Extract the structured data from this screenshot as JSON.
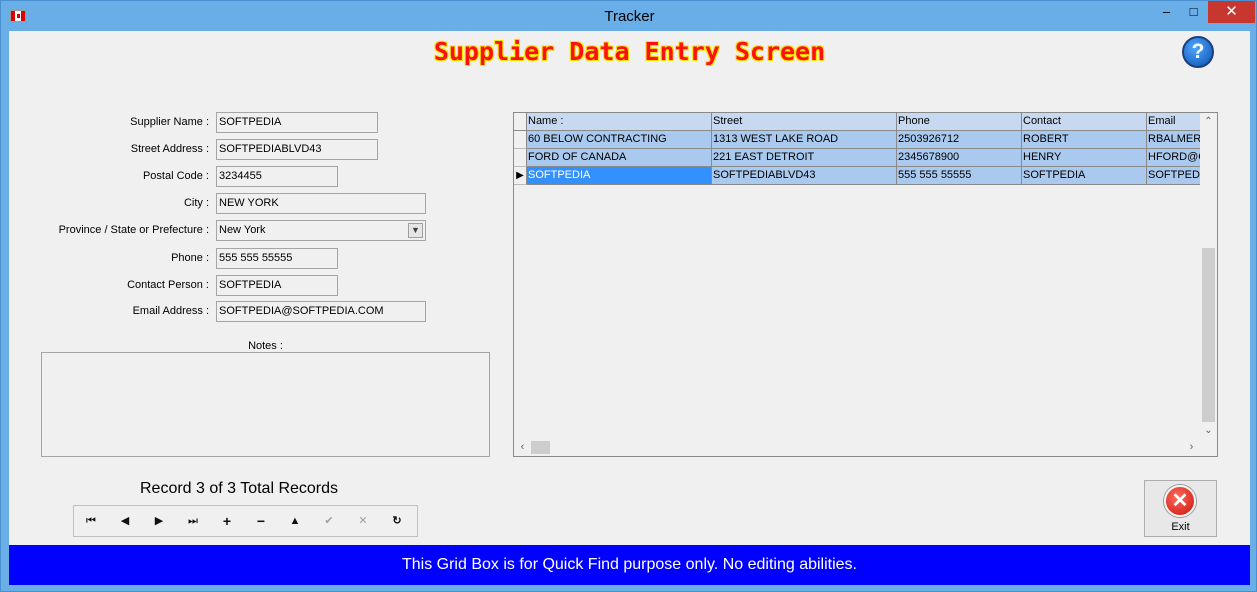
{
  "window": {
    "title": "Tracker",
    "minimize_glyph": "–",
    "maximize_glyph": "□",
    "close_glyph": "✕"
  },
  "screen_title": "Supplier Data Entry Screen",
  "help_glyph": "?",
  "form": {
    "supplier_name": {
      "label": "Supplier Name :",
      "value": "SOFTPEDIA"
    },
    "street_address": {
      "label": "Street Address :",
      "value": "SOFTPEDIABLVD43"
    },
    "postal_code": {
      "label": "Postal Code :",
      "value": "3234455"
    },
    "city": {
      "label": "City :",
      "value": "NEW YORK"
    },
    "province": {
      "label": "Province / State or Prefecture :",
      "value": "New York"
    },
    "phone": {
      "label": "Phone :",
      "value": "555 555 55555"
    },
    "contact_person": {
      "label": "Contact Person :",
      "value": "SOFTPEDIA"
    },
    "email_address": {
      "label": "Email Address :",
      "value": "SOFTPEDIA@SOFTPEDIA.COM"
    },
    "notes": {
      "label": "Notes :",
      "value": ""
    }
  },
  "record_status": "Record 3 of 3 Total Records",
  "navigator": {
    "first": "⏮",
    "prev": "◀",
    "next": "▶",
    "last": "⏭",
    "add": "+",
    "delete": "−",
    "edit": "▲",
    "post": "✔",
    "cancel": "✕",
    "refresh": "↻"
  },
  "grid": {
    "columns": [
      "Name :",
      "Street",
      "Phone",
      "Contact",
      "Email"
    ],
    "rows": [
      [
        "60 BELOW CONTRACTING",
        "1313 WEST LAKE ROAD",
        "2503926712",
        "ROBERT",
        "RBALMER@"
      ],
      [
        "FORD OF CANADA",
        "221 EAST DETROIT",
        "2345678900",
        "HENRY",
        "HFORD@C"
      ],
      [
        "SOFTPEDIA",
        "SOFTPEDIABLVD43",
        "555 555 55555",
        "SOFTPEDIA",
        "SOFTPEDI"
      ]
    ],
    "selected_row": 2
  },
  "exit_button": {
    "label": "Exit",
    "glyph": "✕"
  },
  "footer_text": "This Grid Box is for Quick Find purpose only.  No editing abilities."
}
